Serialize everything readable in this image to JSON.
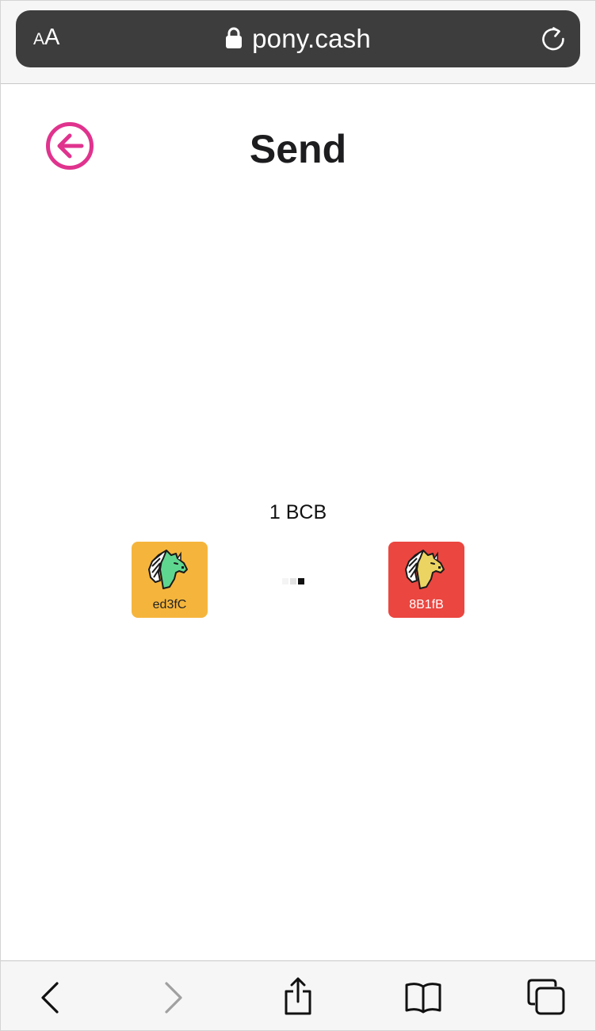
{
  "browser": {
    "reader_small": "A",
    "reader_big": "A",
    "url": "pony.cash"
  },
  "page": {
    "title": "Send",
    "amount": "1 BCB"
  },
  "transfer": {
    "sender": {
      "label": "ed3fC",
      "bg_color": "#f5b53c",
      "pony_color": "#5fd690",
      "label_color": "#222222"
    },
    "receiver": {
      "label": "8B1fB",
      "bg_color": "#eb4640",
      "pony_color": "#ecd462",
      "label_color": "#ffffff"
    },
    "dot_colors": [
      "#f4f4f4",
      "#e3e3e3",
      "#111111"
    ]
  },
  "colors": {
    "accent": "#e0338e",
    "toolbar_icon": "#111111",
    "toolbar_icon_disabled": "#a0a0a0"
  },
  "toolbar": {
    "icons": [
      "back-icon",
      "forward-icon",
      "share-icon",
      "bookmarks-icon",
      "tabs-icon"
    ]
  }
}
